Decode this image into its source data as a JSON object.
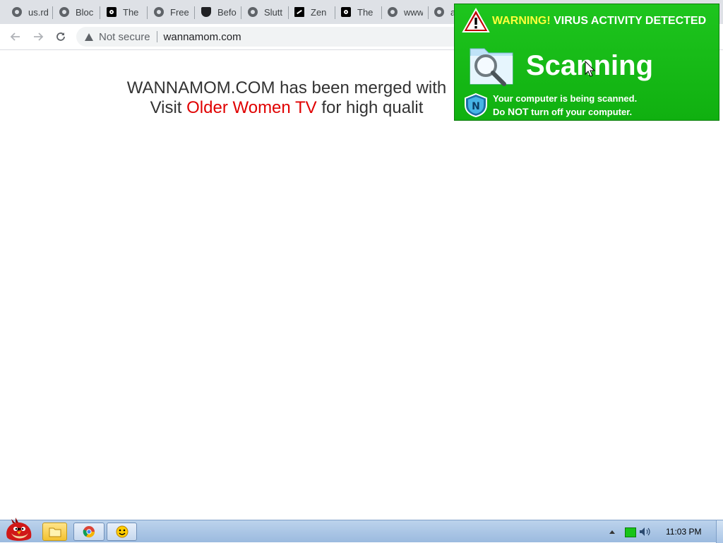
{
  "browser": {
    "tabs": [
      {
        "label": "us.rd",
        "icon": "globe-icon"
      },
      {
        "label": "Bloc",
        "icon": "globe-icon"
      },
      {
        "label": "The",
        "icon": "site-icon"
      },
      {
        "label": "Free",
        "icon": "globe-icon"
      },
      {
        "label": "Befo",
        "icon": "shield-icon"
      },
      {
        "label": "Slutt",
        "icon": "globe-icon"
      },
      {
        "label": "Zen",
        "icon": "zen-icon"
      },
      {
        "label": "The",
        "icon": "site-icon"
      },
      {
        "label": "www",
        "icon": "globe-icon"
      },
      {
        "label": "a",
        "icon": "globe-icon"
      }
    ],
    "security_label": "Not secure",
    "url": "wannamom.com"
  },
  "page": {
    "line1": "WANNAMOM.COM has been merged with",
    "line2_prefix": "Visit",
    "line2_link": "Older Women TV",
    "line2_suffix": "for high qualit"
  },
  "popup": {
    "warning_word": "WARNING!",
    "warning_rest": "VIRUS ACTIVITY DETECTED",
    "scanning": "Scanning",
    "msg_line1": "Your computer is being scanned.",
    "msg_line2_pre": "Do",
    "msg_line2_bold": "NOT",
    "msg_line2_post": "turn off your computer.",
    "accent_green": "#14bb14",
    "accent_yellow": "#ffff3a"
  },
  "taskbar": {
    "clock": "11:03 PM"
  }
}
